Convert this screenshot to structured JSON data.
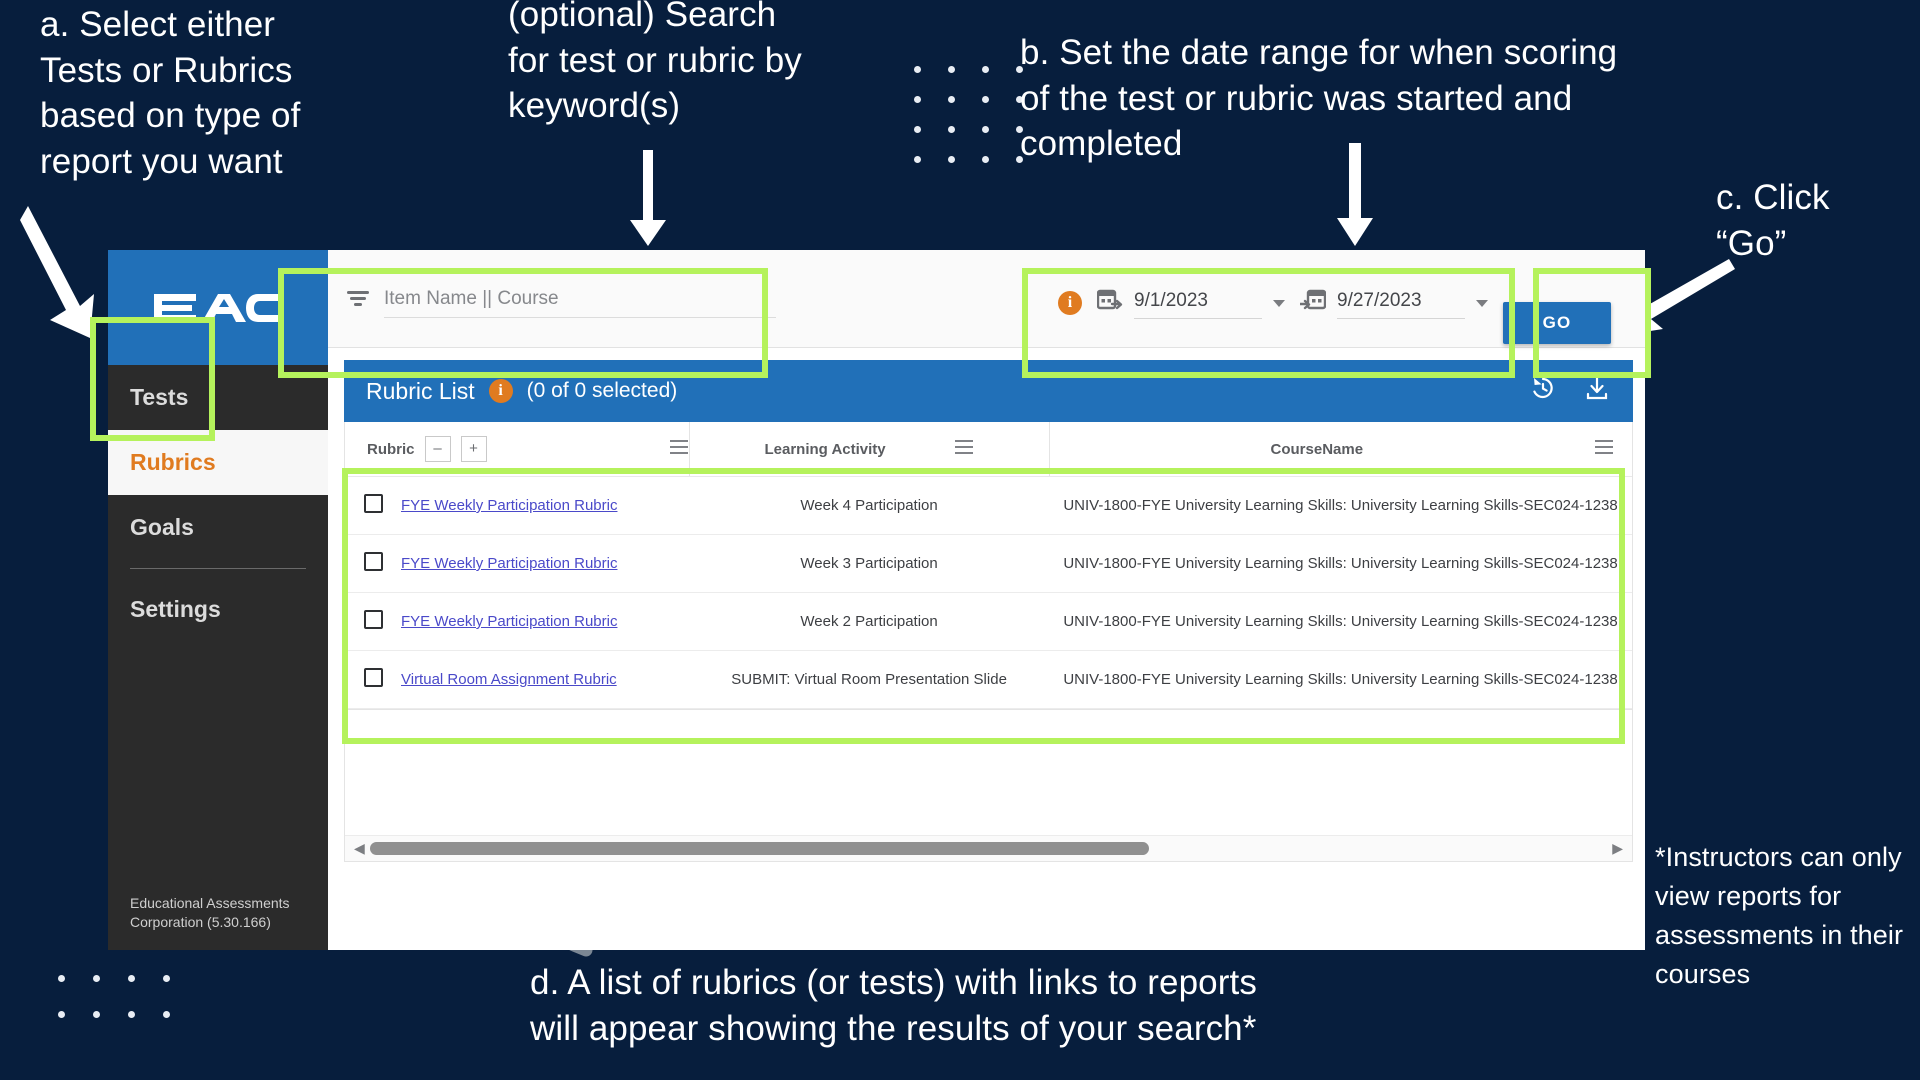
{
  "annotations": {
    "a": "a. Select either\nTests or Rubrics\nbased on type of\nreport you want",
    "optional_search": "(optional) Search\nfor test or rubric by\nkeyword(s)",
    "b": "b. Set the date range for when scoring\nof the test or rubric was started and\ncompleted",
    "c": "c. Click\n“Go”",
    "d": "d. A list of rubrics (or tests) with links to reports\nwill appear showing the results of your search*",
    "footnote": "*Instructors can only view reports for assessments in their courses"
  },
  "colors": {
    "background": "#071e3d",
    "highlight": "#b5f25c",
    "brand_blue": "#2170b8",
    "accent_orange": "#e07b20",
    "sidebar_dark": "#2b2b2b",
    "link_purple": "#4a49c9"
  },
  "app": {
    "logo_text": "EAC",
    "sidebar": {
      "items": [
        {
          "label": "Tests",
          "active": false
        },
        {
          "label": "Rubrics",
          "active": true
        },
        {
          "label": "Goals",
          "active": false
        },
        {
          "label": "Settings",
          "active": false
        }
      ],
      "footer": "Educational Assessments\nCorporation (5.30.166)"
    },
    "filterbar": {
      "search_placeholder": "Item Name || Course",
      "search_value": "",
      "filter_icon": "filter-icon",
      "info_icon": "info-icon",
      "start_date": "9/1/2023",
      "end_date": "9/27/2023",
      "go_label": "GO"
    },
    "list_panel": {
      "title": "Rubric List",
      "info_icon": "info-icon",
      "selected_count": "(0 of 0 selected)",
      "restore_icon": "history-restore-icon",
      "download_icon": "download-icon",
      "columns": [
        {
          "label": "Rubric",
          "menu_icon": "hamburger-menu-icon",
          "minus": "–",
          "plus": "+"
        },
        {
          "label": "Learning Activity",
          "menu_icon": "hamburger-menu-icon"
        },
        {
          "label": "CourseName",
          "menu_icon": "hamburger-menu-icon"
        }
      ],
      "rows": [
        {
          "checked": false,
          "rubric": "FYE Weekly Participation Rubric",
          "activity": "Week 4 Participation",
          "course": "UNIV-1800-FYE University Learning Skills: University Learning Skills-SEC024-1238"
        },
        {
          "checked": false,
          "rubric": "FYE Weekly Participation Rubric",
          "activity": "Week 3 Participation",
          "course": "UNIV-1800-FYE University Learning Skills: University Learning Skills-SEC024-1238"
        },
        {
          "checked": false,
          "rubric": "FYE Weekly Participation Rubric",
          "activity": "Week 2 Participation",
          "course": "UNIV-1800-FYE University Learning Skills: University Learning Skills-SEC024-1238"
        },
        {
          "checked": false,
          "rubric": "Virtual Room Assignment Rubric",
          "activity": "SUBMIT: Virtual Room Presentation Slide",
          "course": "UNIV-1800-FYE University Learning Skills: University Learning Skills-SEC024-1238"
        }
      ],
      "scroll_left_icon": "◀",
      "scroll_right_icon": "▶"
    }
  }
}
